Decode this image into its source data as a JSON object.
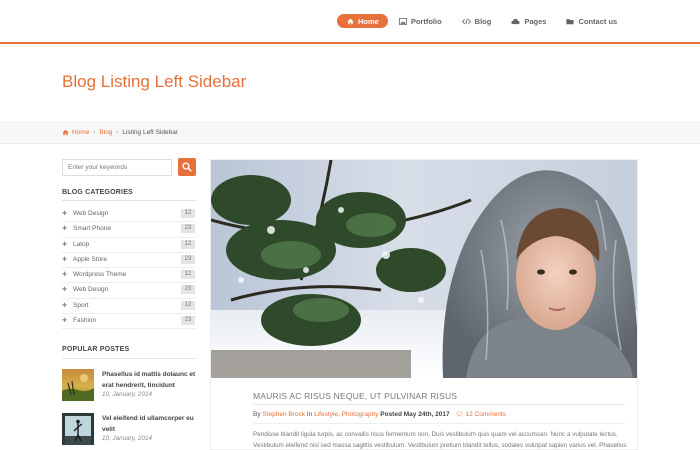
{
  "nav": {
    "items": [
      {
        "label": "Home",
        "icon": "home-icon",
        "active": true
      },
      {
        "label": "Portfolio",
        "icon": "image-icon",
        "active": false
      },
      {
        "label": "Blog",
        "icon": "code-icon",
        "active": false
      },
      {
        "label": "Pages",
        "icon": "cloud-icon",
        "active": false
      },
      {
        "label": "Contact us",
        "icon": "folder-icon",
        "active": false
      }
    ]
  },
  "page": {
    "title": "Blog Listing Left Sidebar"
  },
  "breadcrumb": {
    "home": "Home",
    "blog": "Blog",
    "current": "Listing Left Sidebar"
  },
  "sidebar": {
    "search": {
      "placeholder": "Enter your keywords",
      "value": ""
    },
    "categories_heading": "BLOG CATEGORIES",
    "categories": [
      {
        "label": "Web Design",
        "count": "12"
      },
      {
        "label": "Smart Phone",
        "count": "23"
      },
      {
        "label": "Latop",
        "count": "12"
      },
      {
        "label": "Apple Store",
        "count": "23"
      },
      {
        "label": "Wordpress Theme",
        "count": "12"
      },
      {
        "label": "Web Design",
        "count": "23"
      },
      {
        "label": "Sport",
        "count": "12"
      },
      {
        "label": "Fashion",
        "count": "23"
      }
    ],
    "popular_heading": "POPULAR POSTES",
    "popular": [
      {
        "title": "Phasellus id mattis dolaunc et erat hendrerit, tincidunt",
        "date": "10, January, 2014"
      },
      {
        "title": "Vel eleifend id ullamcorper eu velit",
        "date": "10, January, 2014"
      }
    ]
  },
  "post": {
    "title": "MAURIS AC RISUS NEQUE, UT PULVINAR RISUS",
    "by": "By",
    "author": "Stephen Brock",
    "in": "In",
    "cat1": "Lifestyle",
    "cat_sep": ",",
    "cat2": "Photography",
    "posted_label": "Posted",
    "date": "May 24th, 2017",
    "comments": "12 Comments",
    "excerpt": "Pendisse blandit ligula turpis, ac convallis risus fermentum non. Duis vestibulum quis quam vel accumsan. Nunc a vulputate lectus. Vestibulum eleifend nisl sed massa sagittis vestibulum. Vestibulum pretium blandit tellus, sodales volutpat sapien varius vel. Phasellus"
  },
  "colors": {
    "accent": "#e8703a"
  }
}
